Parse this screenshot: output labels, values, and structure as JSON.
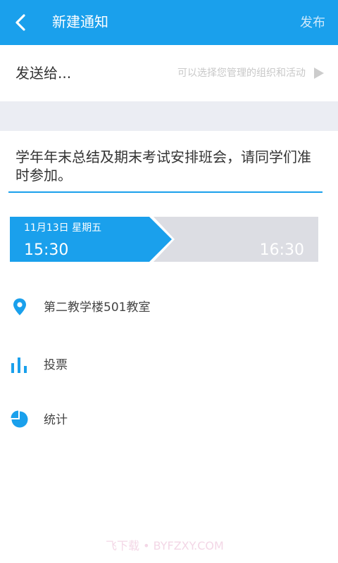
{
  "header": {
    "title": "新建通知",
    "publish_label": "发布",
    "bg_color": "#1aa0ec"
  },
  "send_to": {
    "label": "发送给...",
    "hint": "可以选择您管理的组织和活动"
  },
  "notice": {
    "content": "学年年末总结及期末考试安排班会，请同学们准时参加。"
  },
  "time": {
    "start_date": "11月13日  星期五",
    "start_time": "15:30",
    "end_time": "16:30",
    "active_color": "#1aa0ec",
    "inactive_color": "#dcdde3"
  },
  "options": {
    "location": "第二教学楼501教室",
    "vote": "投票",
    "stats": "统计"
  },
  "watermark": "飞下载 • BYFZXY.COM"
}
